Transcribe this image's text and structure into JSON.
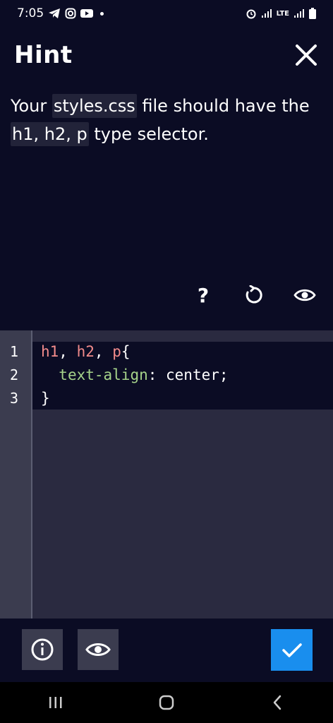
{
  "status_bar": {
    "time": "7:05",
    "left_icons": [
      "telegram-icon",
      "instagram-icon",
      "youtube-icon",
      "notification-dot"
    ],
    "right_icons": [
      "alarm-icon",
      "signal-icon",
      "lte-icon",
      "signal-icon-2",
      "battery-icon"
    ],
    "network": "LTE"
  },
  "hint": {
    "title": "Hint",
    "text_parts": {
      "p1": "Your ",
      "code1": "styles.css",
      "p2": " file should have the ",
      "code2": "h1, h2, p",
      "p3": " type selector."
    }
  },
  "actions": {
    "help_label": "?",
    "icons": [
      "question-icon",
      "reset-icon",
      "eye-icon"
    ]
  },
  "editor": {
    "line_numbers": [
      "1",
      "2",
      "3"
    ],
    "lines": {
      "l1_sel1": "h1",
      "l1_p1": ", ",
      "l1_sel2": "h2",
      "l1_p2": ", ",
      "l1_sel3": "p",
      "l1_p3": "{",
      "l2_indent": "  ",
      "l2_prop": "text-align",
      "l2_rest": ": center;",
      "l3": "}"
    }
  },
  "bottom_bar": {
    "buttons": [
      "info-icon",
      "eye-icon",
      "check-icon"
    ]
  },
  "colors": {
    "background": "#0b0c24",
    "editor_bg": "#2a2a40",
    "gutter_bg": "#3b3c4f",
    "selector": "#f28b8b",
    "property": "#a6d38a",
    "submit": "#198eee"
  }
}
